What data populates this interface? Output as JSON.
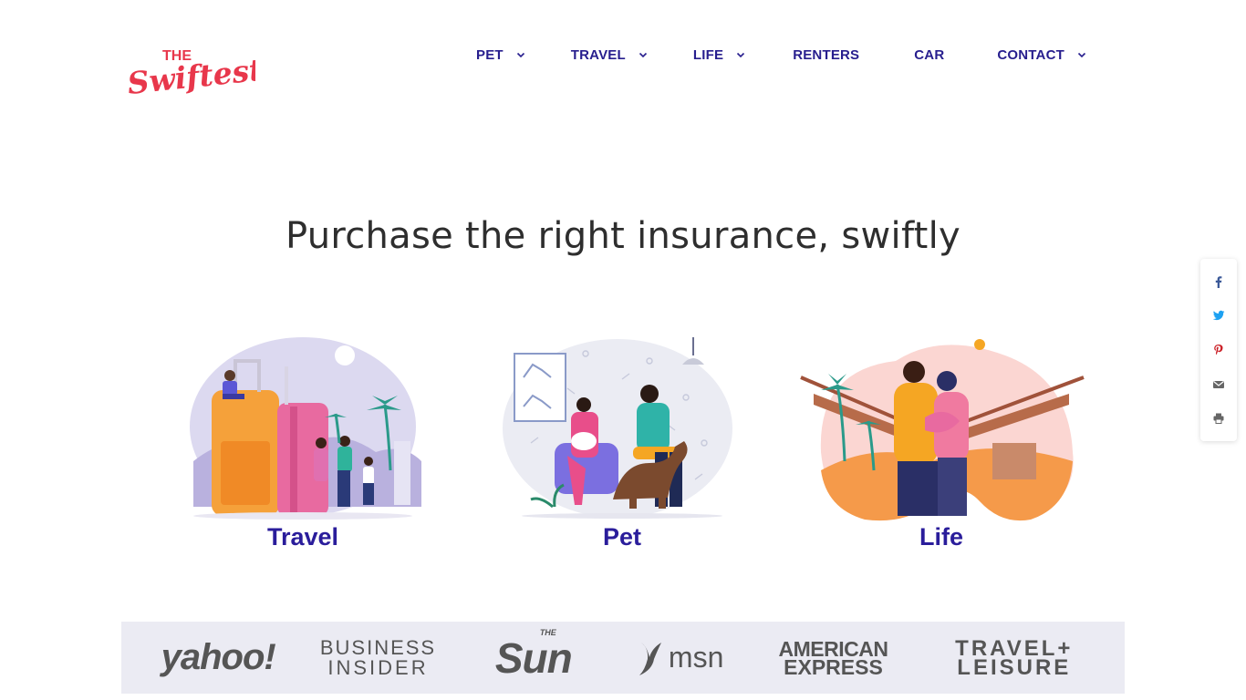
{
  "brand": {
    "line1": "THE",
    "line2": "Swiftest",
    "color": "#e8374b"
  },
  "nav": {
    "items": [
      {
        "label": "PET",
        "has_dropdown": true
      },
      {
        "label": "TRAVEL",
        "has_dropdown": true
      },
      {
        "label": "LIFE",
        "has_dropdown": true
      },
      {
        "label": "RENTERS",
        "has_dropdown": false
      },
      {
        "label": "CAR",
        "has_dropdown": false
      },
      {
        "label": "CONTACT",
        "has_dropdown": true
      }
    ],
    "color": "#271e8e"
  },
  "hero": {
    "headline": "Purchase the right insurance, swiftly"
  },
  "cards": [
    {
      "label": "Travel",
      "illustration": "travel-illustration"
    },
    {
      "label": "Pet",
      "illustration": "pet-illustration"
    },
    {
      "label": "Life",
      "illustration": "life-illustration"
    }
  ],
  "share": {
    "buttons": [
      {
        "icon": "facebook-icon",
        "color": "#3b5998"
      },
      {
        "icon": "twitter-icon",
        "color": "#1da1f2"
      },
      {
        "icon": "pinterest-icon",
        "color": "#cb2027"
      },
      {
        "icon": "email-icon",
        "color": "#666666"
      },
      {
        "icon": "print-icon",
        "color": "#666666"
      }
    ]
  },
  "press": {
    "logos": [
      {
        "text": "yahoo!"
      },
      {
        "line1": "BUSINESS",
        "line2": "INSIDER"
      },
      {
        "small": "THE",
        "text": "Sun"
      },
      {
        "text": "msn"
      },
      {
        "line1": "AMERICAN",
        "line2": "EXPRESS"
      },
      {
        "line1": "TRAVEL+",
        "line2": "LEISURE"
      }
    ]
  }
}
